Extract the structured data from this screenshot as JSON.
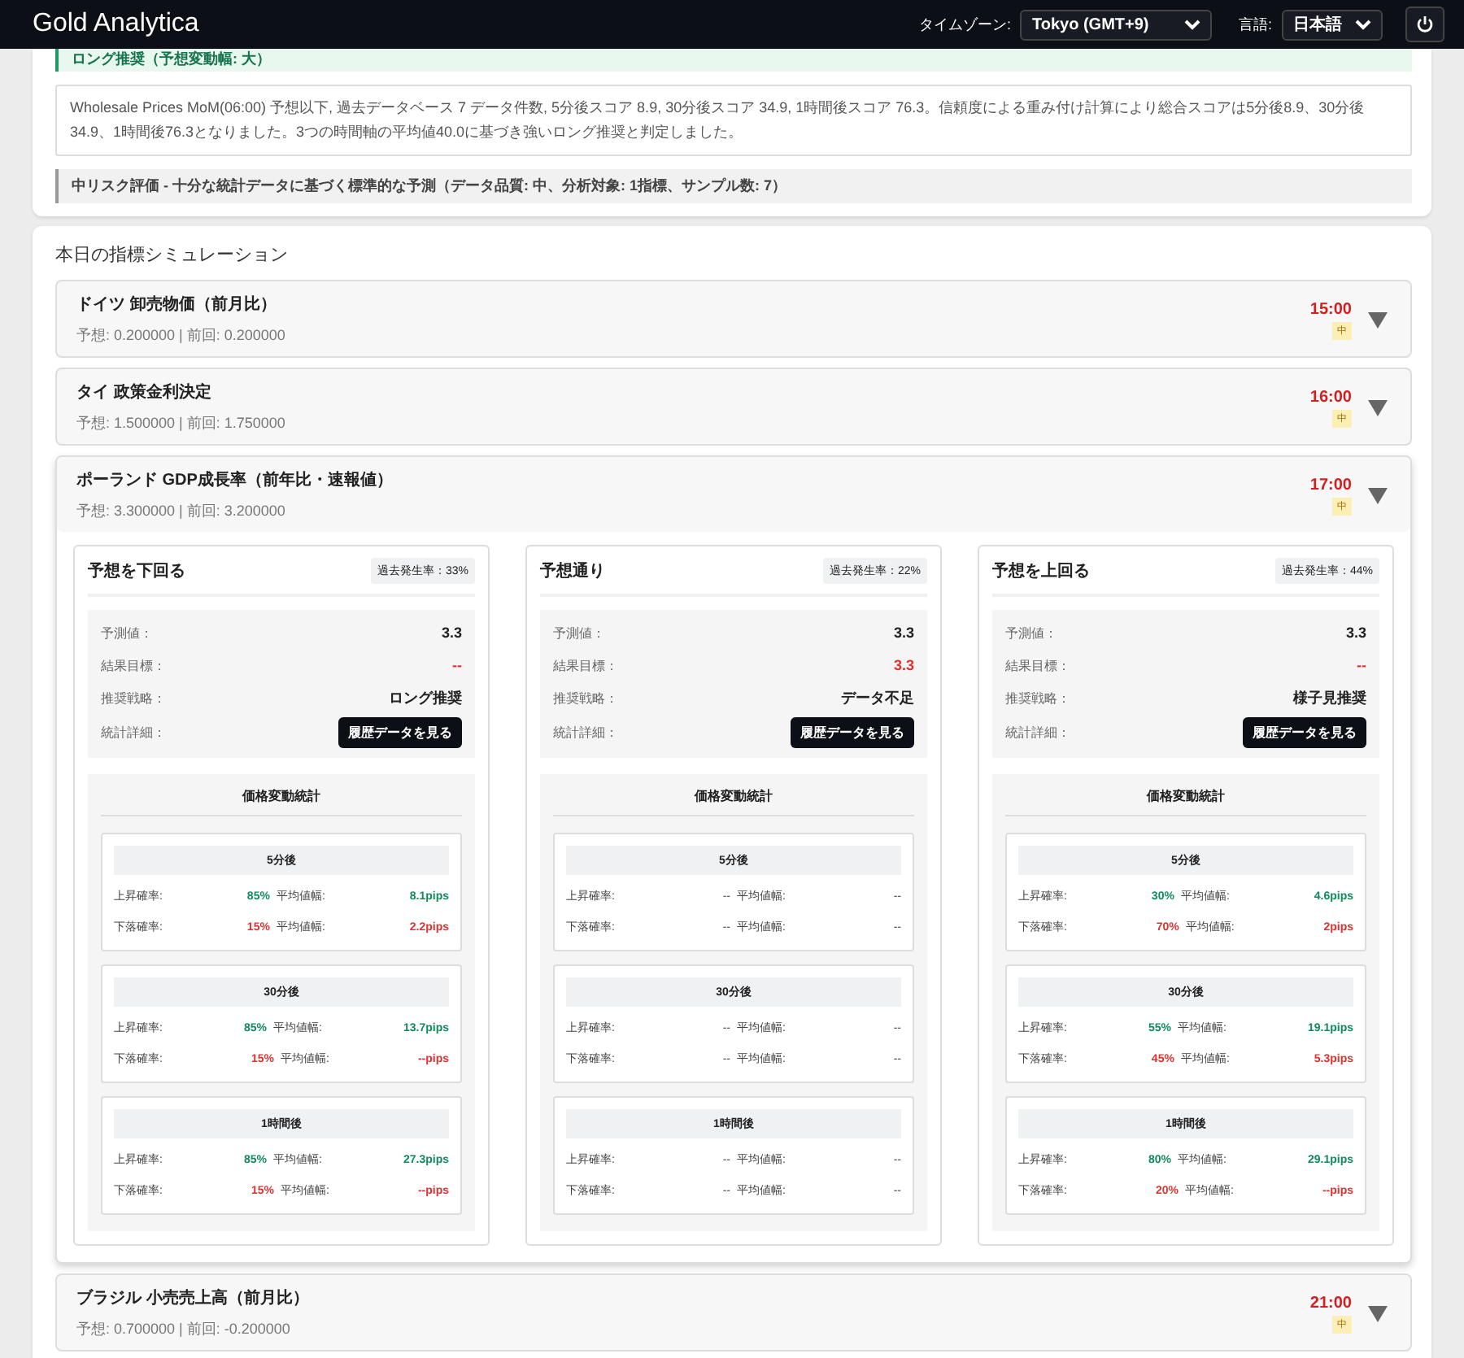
{
  "header": {
    "brand": "Gold Analytica",
    "timezone_label": "タイムゾーン:",
    "timezone_value": "Tokyo (GMT+9)",
    "language_label": "言語:",
    "language_value": "日本語"
  },
  "summary": {
    "recommendation": "ロング推奨（予想変動幅: 大）",
    "explanation": "Wholesale Prices MoM(06:00) 予想以下, 過去データベース 7 データ件数, 5分後スコア 8.9, 30分後スコア 34.9, 1時間後スコア 76.3。信頼度による重み付け計算により総合スコアは5分後8.9、30分後34.9、1時間後76.3となりました。3つの時間軸の平均値40.0に基づき強いロング推奨と判定しました。",
    "risk": "中リスク評価 - 十分な統計データに基づく標準的な予測（データ品質: 中、分析対象: 1指標、サンプル数: 7）"
  },
  "simulation": {
    "title": "本日の指標シミュレーション",
    "events": [
      {
        "name": "ドイツ 卸売物価（前月比）",
        "detail": "予想: 0.200000 | 前回: 0.200000",
        "time": "15:00",
        "importance": "中",
        "expanded": false
      },
      {
        "name": "タイ 政策金利決定",
        "detail": "予想: 1.500000 | 前回: 1.750000",
        "time": "16:00",
        "importance": "中",
        "expanded": false
      },
      {
        "name": "ポーランド GDP成長率（前年比・速報値）",
        "detail": "予想: 3.300000 | 前回: 3.200000",
        "time": "17:00",
        "importance": "中",
        "expanded": true,
        "scenarios": [
          {
            "title": "予想を下回る",
            "rate": "過去発生率：33%",
            "has_data": true,
            "rows": [
              {
                "kind": "value",
                "label": "予測値：",
                "value": "3.3"
              },
              {
                "kind": "target",
                "label": "結果目標：",
                "value": "--"
              },
              {
                "kind": "value",
                "label": "推奨戦略：",
                "value": "ロング推奨"
              },
              {
                "kind": "button",
                "label": "統計詳細：",
                "value": "履歴データを見る"
              }
            ],
            "stats_title": "価格変動統計",
            "periods": [
              {
                "title": "5分後",
                "lines": [
                  {
                    "kind": "up",
                    "label": "上昇確率:",
                    "rate": "85%",
                    "pips_label": "平均値幅:",
                    "pips": "8.1pips"
                  },
                  {
                    "kind": "down",
                    "label": "下落確率:",
                    "rate": "15%",
                    "pips_label": "平均値幅:",
                    "pips": "2.2pips"
                  }
                ]
              },
              {
                "title": "30分後",
                "lines": [
                  {
                    "kind": "up",
                    "label": "上昇確率:",
                    "rate": "85%",
                    "pips_label": "平均値幅:",
                    "pips": "13.7pips"
                  },
                  {
                    "kind": "down",
                    "label": "下落確率:",
                    "rate": "15%",
                    "pips_label": "平均値幅:",
                    "pips": "--pips"
                  }
                ]
              },
              {
                "title": "1時間後",
                "lines": [
                  {
                    "kind": "up",
                    "label": "上昇確率:",
                    "rate": "85%",
                    "pips_label": "平均値幅:",
                    "pips": "27.3pips"
                  },
                  {
                    "kind": "down",
                    "label": "下落確率:",
                    "rate": "15%",
                    "pips_label": "平均値幅:",
                    "pips": "--pips"
                  }
                ]
              }
            ]
          },
          {
            "title": "予想通り",
            "rate": "過去発生率：22%",
            "has_data": false,
            "rows": [
              {
                "kind": "value",
                "label": "予測値：",
                "value": "3.3"
              },
              {
                "kind": "target",
                "label": "結果目標：",
                "value": "3.3"
              },
              {
                "kind": "value",
                "label": "推奨戦略：",
                "value": "データ不足"
              },
              {
                "kind": "button",
                "label": "統計詳細：",
                "value": "履歴データを見る"
              }
            ],
            "stats_title": "価格変動統計",
            "periods": [
              {
                "title": "5分後",
                "lines": [
                  {
                    "kind": "up",
                    "label": "上昇確率:",
                    "rate": "--",
                    "pips_label": "平均値幅:",
                    "pips": "--"
                  },
                  {
                    "kind": "down",
                    "label": "下落確率:",
                    "rate": "--",
                    "pips_label": "平均値幅:",
                    "pips": "--"
                  }
                ]
              },
              {
                "title": "30分後",
                "lines": [
                  {
                    "kind": "up",
                    "label": "上昇確率:",
                    "rate": "--",
                    "pips_label": "平均値幅:",
                    "pips": "--"
                  },
                  {
                    "kind": "down",
                    "label": "下落確率:",
                    "rate": "--",
                    "pips_label": "平均値幅:",
                    "pips": "--"
                  }
                ]
              },
              {
                "title": "1時間後",
                "lines": [
                  {
                    "kind": "up",
                    "label": "上昇確率:",
                    "rate": "--",
                    "pips_label": "平均値幅:",
                    "pips": "--"
                  },
                  {
                    "kind": "down",
                    "label": "下落確率:",
                    "rate": "--",
                    "pips_label": "平均値幅:",
                    "pips": "--"
                  }
                ]
              }
            ]
          },
          {
            "title": "予想を上回る",
            "rate": "過去発生率：44%",
            "has_data": true,
            "rows": [
              {
                "kind": "value",
                "label": "予測値：",
                "value": "3.3"
              },
              {
                "kind": "target",
                "label": "結果目標：",
                "value": "--"
              },
              {
                "kind": "value",
                "label": "推奨戦略：",
                "value": "様子見推奨"
              },
              {
                "kind": "button",
                "label": "統計詳細：",
                "value": "履歴データを見る"
              }
            ],
            "stats_title": "価格変動統計",
            "periods": [
              {
                "title": "5分後",
                "lines": [
                  {
                    "kind": "up",
                    "label": "上昇確率:",
                    "rate": "30%",
                    "pips_label": "平均値幅:",
                    "pips": "4.6pips"
                  },
                  {
                    "kind": "down",
                    "label": "下落確率:",
                    "rate": "70%",
                    "pips_label": "平均値幅:",
                    "pips": "2pips"
                  }
                ]
              },
              {
                "title": "30分後",
                "lines": [
                  {
                    "kind": "up",
                    "label": "上昇確率:",
                    "rate": "55%",
                    "pips_label": "平均値幅:",
                    "pips": "19.1pips"
                  },
                  {
                    "kind": "down",
                    "label": "下落確率:",
                    "rate": "45%",
                    "pips_label": "平均値幅:",
                    "pips": "5.3pips"
                  }
                ]
              },
              {
                "title": "1時間後",
                "lines": [
                  {
                    "kind": "up",
                    "label": "上昇確率:",
                    "rate": "80%",
                    "pips_label": "平均値幅:",
                    "pips": "29.1pips"
                  },
                  {
                    "kind": "down",
                    "label": "下落確率:",
                    "rate": "20%",
                    "pips_label": "平均値幅:",
                    "pips": "--pips"
                  }
                ]
              }
            ]
          }
        ]
      },
      {
        "name": "ブラジル 小売売上高（前月比）",
        "detail": "予想: 0.700000 | 前回: -0.200000",
        "time": "21:00",
        "importance": "中",
        "expanded": false
      }
    ]
  }
}
